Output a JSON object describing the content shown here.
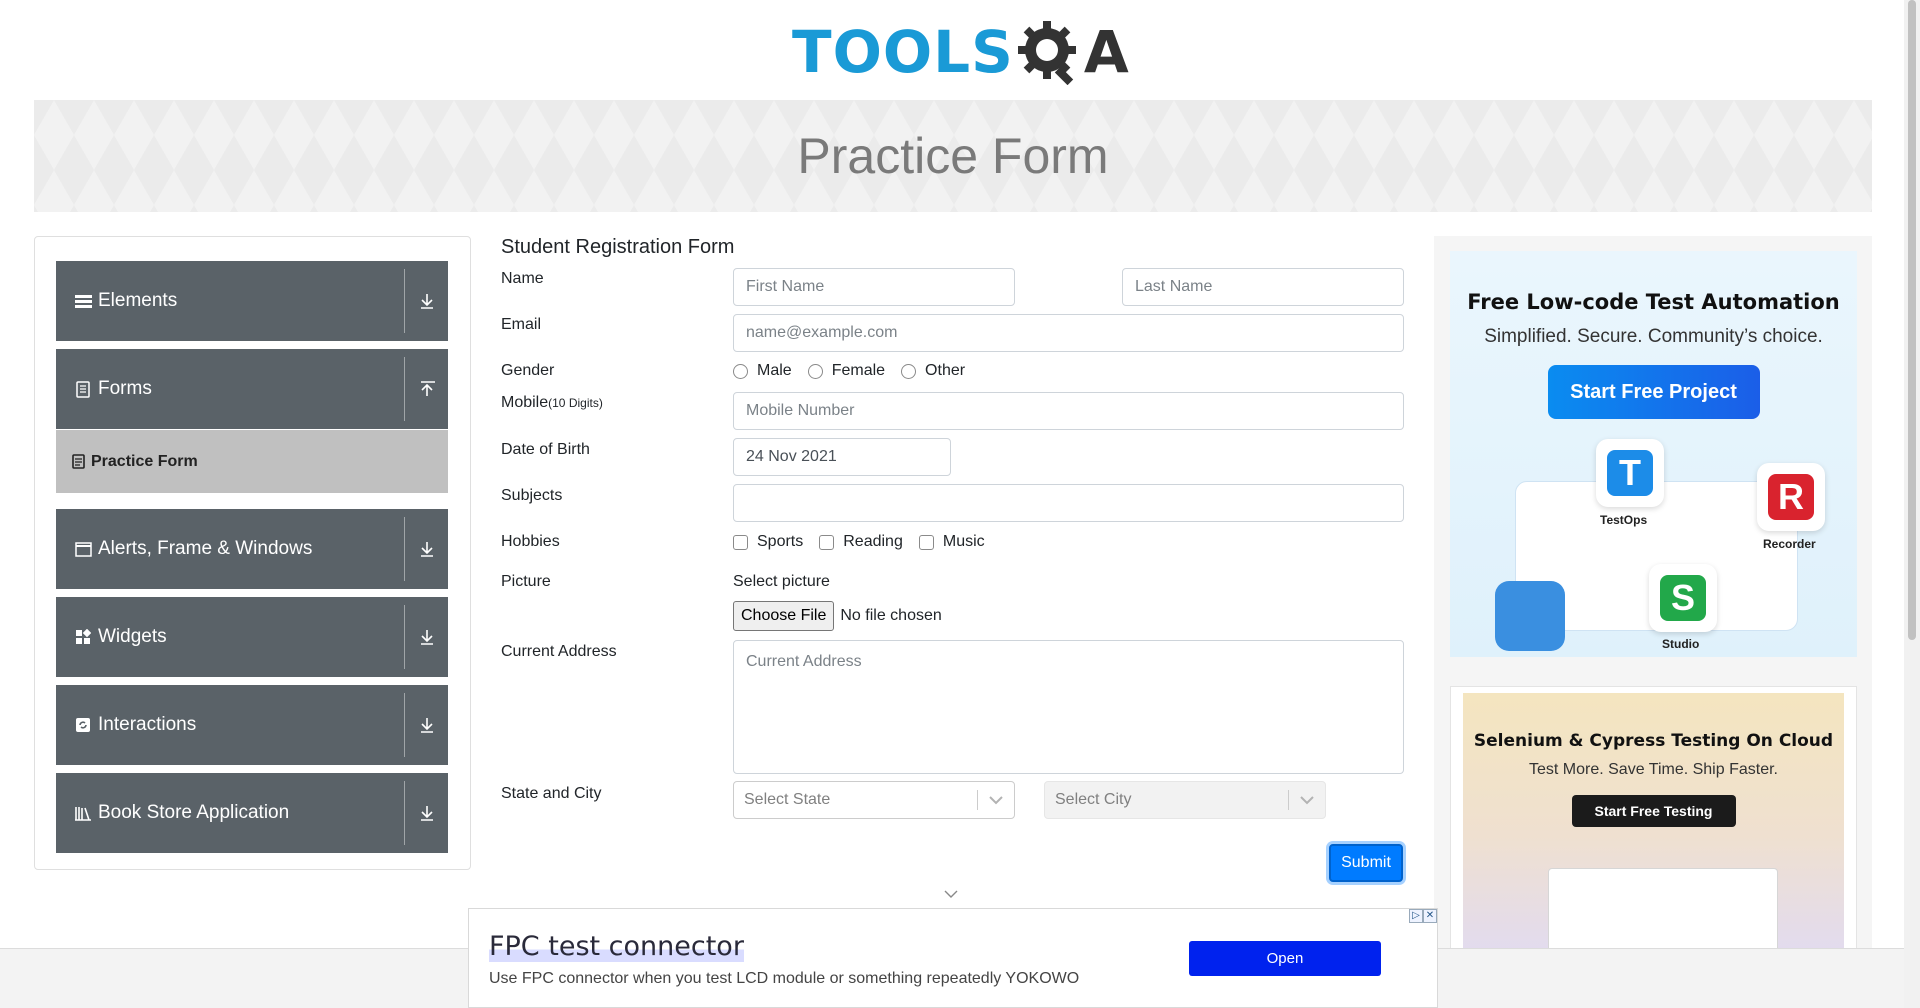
{
  "logo": {
    "part1": "TOOLS",
    "part2": "A"
  },
  "banner": {
    "title": "Practice Form"
  },
  "sidebar": {
    "groups": [
      {
        "label": "Elements",
        "icon": "list-icon",
        "expanded": false
      },
      {
        "label": "Forms",
        "icon": "document-icon",
        "expanded": true
      },
      {
        "label": "Alerts, Frame & Windows",
        "icon": "window-icon",
        "expanded": false
      },
      {
        "label": "Widgets",
        "icon": "widgets-icon",
        "expanded": false
      },
      {
        "label": "Interactions",
        "icon": "interactions-icon",
        "expanded": false
      },
      {
        "label": "Book Store Application",
        "icon": "books-icon",
        "expanded": false
      }
    ],
    "active_item": {
      "label": "Practice Form",
      "icon": "form-icon"
    }
  },
  "form": {
    "title": "Student Registration Form",
    "labels": {
      "name": "Name",
      "email": "Email",
      "gender": "Gender",
      "mobile": "Mobile",
      "mobile_hint": "(10 Digits)",
      "dob": "Date of Birth",
      "subjects": "Subjects",
      "hobbies": "Hobbies",
      "picture": "Picture",
      "address": "Current Address",
      "state_city": "State and City"
    },
    "first_name_placeholder": "First Name",
    "last_name_placeholder": "Last Name",
    "email_placeholder": "name@example.com",
    "gender_options": [
      "Male",
      "Female",
      "Other"
    ],
    "mobile_placeholder": "Mobile Number",
    "dob_value": "24 Nov 2021",
    "subjects_value": "",
    "hobby_options": [
      "Sports",
      "Reading",
      "Music"
    ],
    "picture_prompt": "Select picture",
    "file_button": "Choose File",
    "file_status": "No file chosen",
    "address_placeholder": "Current Address",
    "state_placeholder": "Select State",
    "city_placeholder": "Select City",
    "submit": "Submit"
  },
  "ads": {
    "ad1": {
      "headline": "Free Low-code Test Automation",
      "sub": "Simplified. Secure. Community’s choice.",
      "button": "Start Free Project",
      "products": [
        "TestOps",
        "Recorder",
        "Studio"
      ]
    },
    "ad2": {
      "headline": "Selenium & Cypress Testing On Cloud",
      "sub": "Test More. Save Time. Ship Faster.",
      "button": "Start Free Testing"
    },
    "bottom": {
      "title": "FPC test connector",
      "description": "Use FPC connector when you test LCD module or something repeatedly YOKOWO",
      "button": "Open"
    }
  },
  "colors": {
    "accent": "#007bff",
    "sidebar": "#5a6268",
    "logo_blue": "#1a9ad6"
  }
}
